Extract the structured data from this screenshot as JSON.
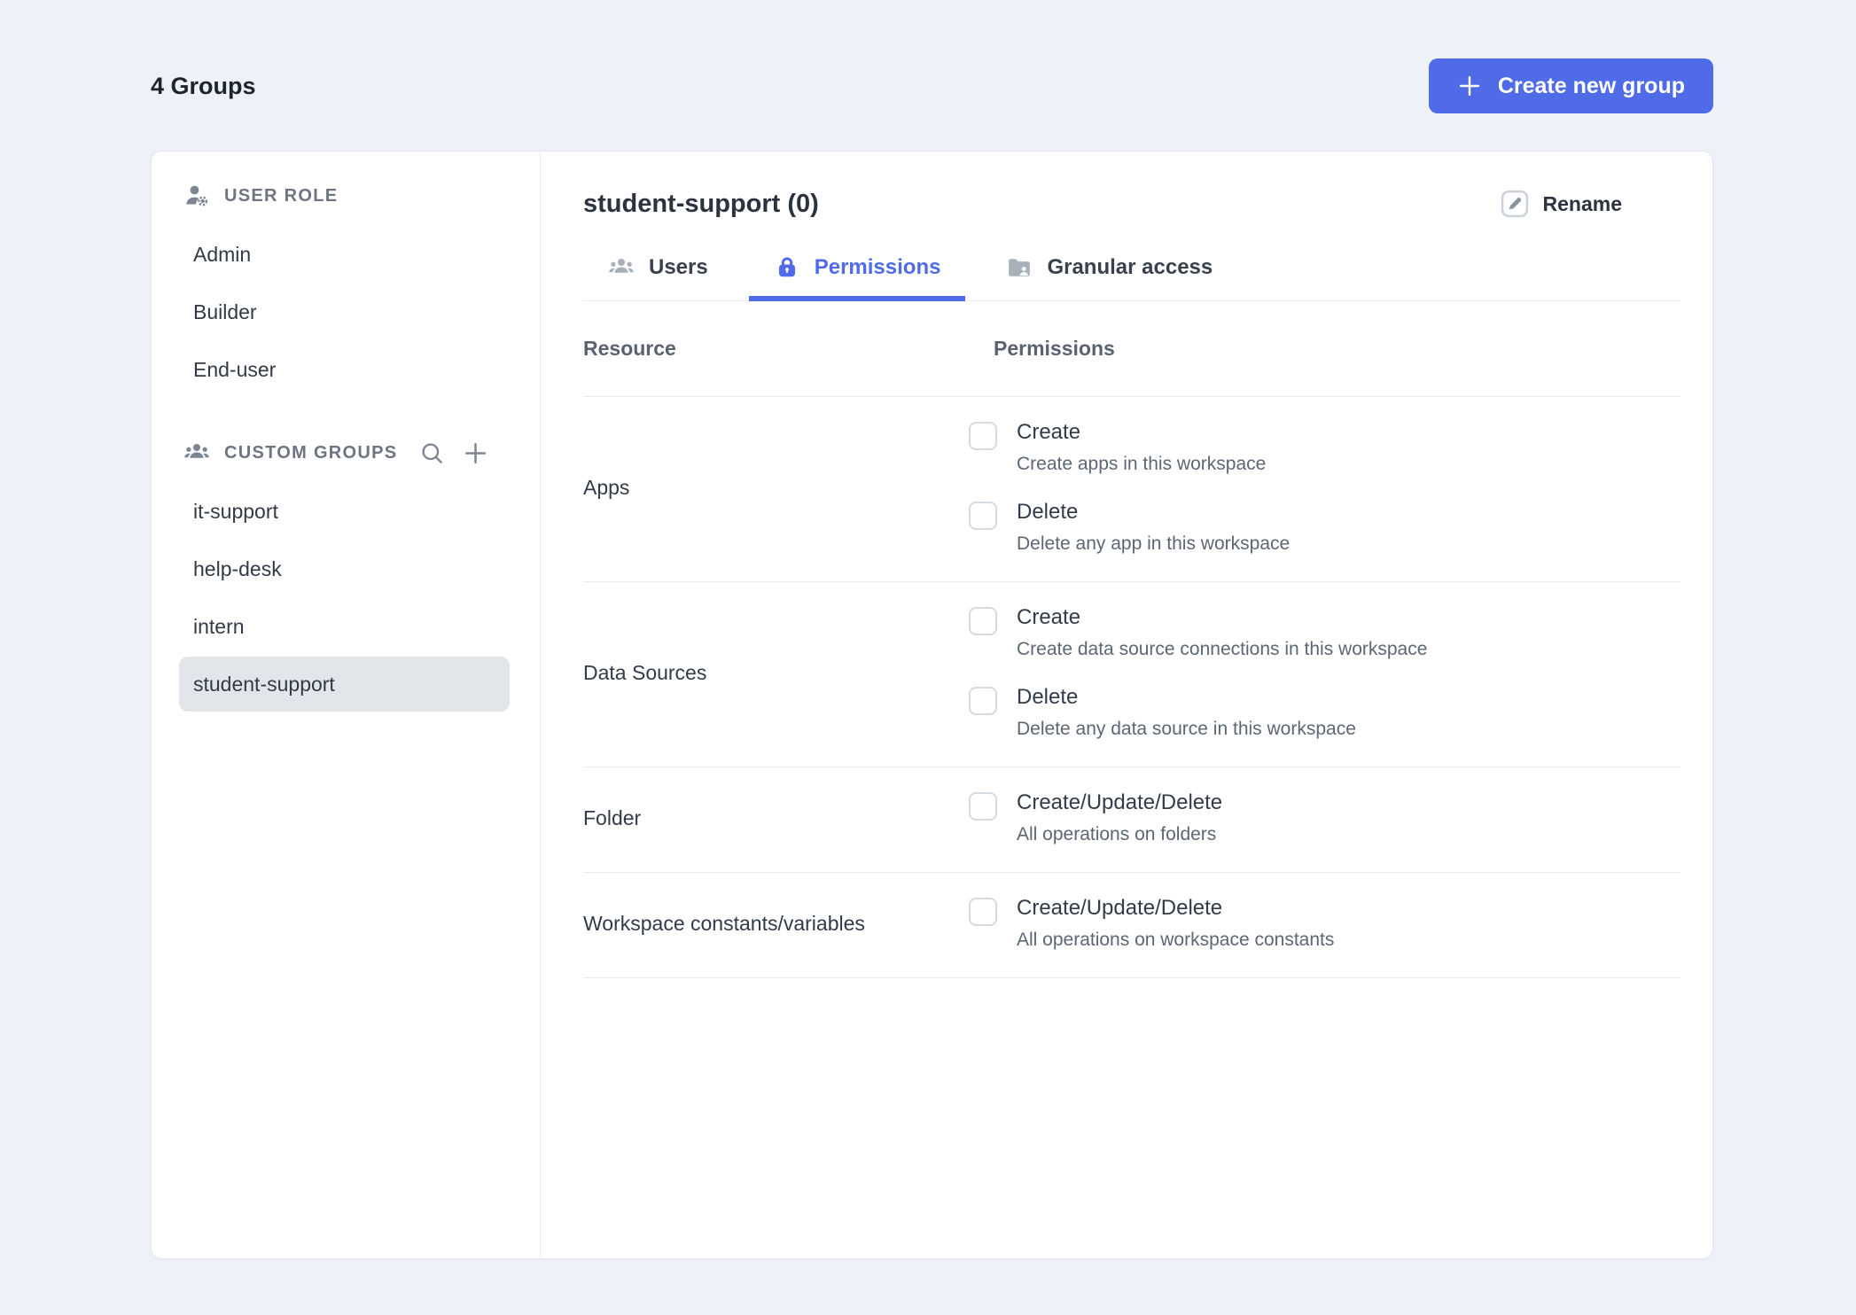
{
  "page": {
    "heading": "4 Groups"
  },
  "header": {
    "create_button": {
      "label": "Create new group",
      "icon": "plus"
    }
  },
  "sidebar": {
    "user_role": {
      "label": "USER ROLE",
      "icon": "user-gear",
      "items": [
        "Admin",
        "Builder",
        "End-user"
      ]
    },
    "custom_groups": {
      "label": "CUSTOM GROUPS",
      "icon": "users-group",
      "actions": [
        {
          "name": "search-group",
          "icon": "search"
        },
        {
          "name": "add-group",
          "icon": "plus"
        }
      ],
      "items": [
        "it-support",
        "help-desk",
        "intern",
        "student-support"
      ],
      "selected": "student-support"
    }
  },
  "main": {
    "title": "student-support (0)",
    "rename": {
      "label": "Rename",
      "icon": "pencil-square"
    },
    "tabs": [
      {
        "label": "Users",
        "icon": "users",
        "active": false
      },
      {
        "label": "Permissions",
        "icon": "lock",
        "active": true
      },
      {
        "label": "Granular access",
        "icon": "folder-user",
        "active": false
      }
    ],
    "table": {
      "columns": [
        "Resource",
        "Permissions"
      ],
      "rows": [
        {
          "resource": "Apps",
          "permissions": [
            {
              "label": "Create",
              "description": "Create apps in this workspace",
              "checked": false
            },
            {
              "label": "Delete",
              "description": "Delete any app in this workspace",
              "checked": false
            }
          ]
        },
        {
          "resource": "Data Sources",
          "permissions": [
            {
              "label": "Create",
              "description": "Create data source connections in this workspace",
              "checked": false
            },
            {
              "label": "Delete",
              "description": "Delete any data source in this workspace",
              "checked": false
            }
          ]
        },
        {
          "resource": "Folder",
          "permissions": [
            {
              "label": "Create/Update/Delete",
              "description": "All operations on folders",
              "checked": false
            }
          ]
        },
        {
          "resource": "Workspace constants/variables",
          "permissions": [
            {
              "label": "Create/Update/Delete",
              "description": "All operations on workspace constants",
              "checked": false
            }
          ]
        }
      ]
    }
  },
  "colors": {
    "accent": "#4f6be8",
    "page_background": "#eef2f8",
    "selected_item_background": "#e2e6eb",
    "divider": "#e9edf2"
  }
}
